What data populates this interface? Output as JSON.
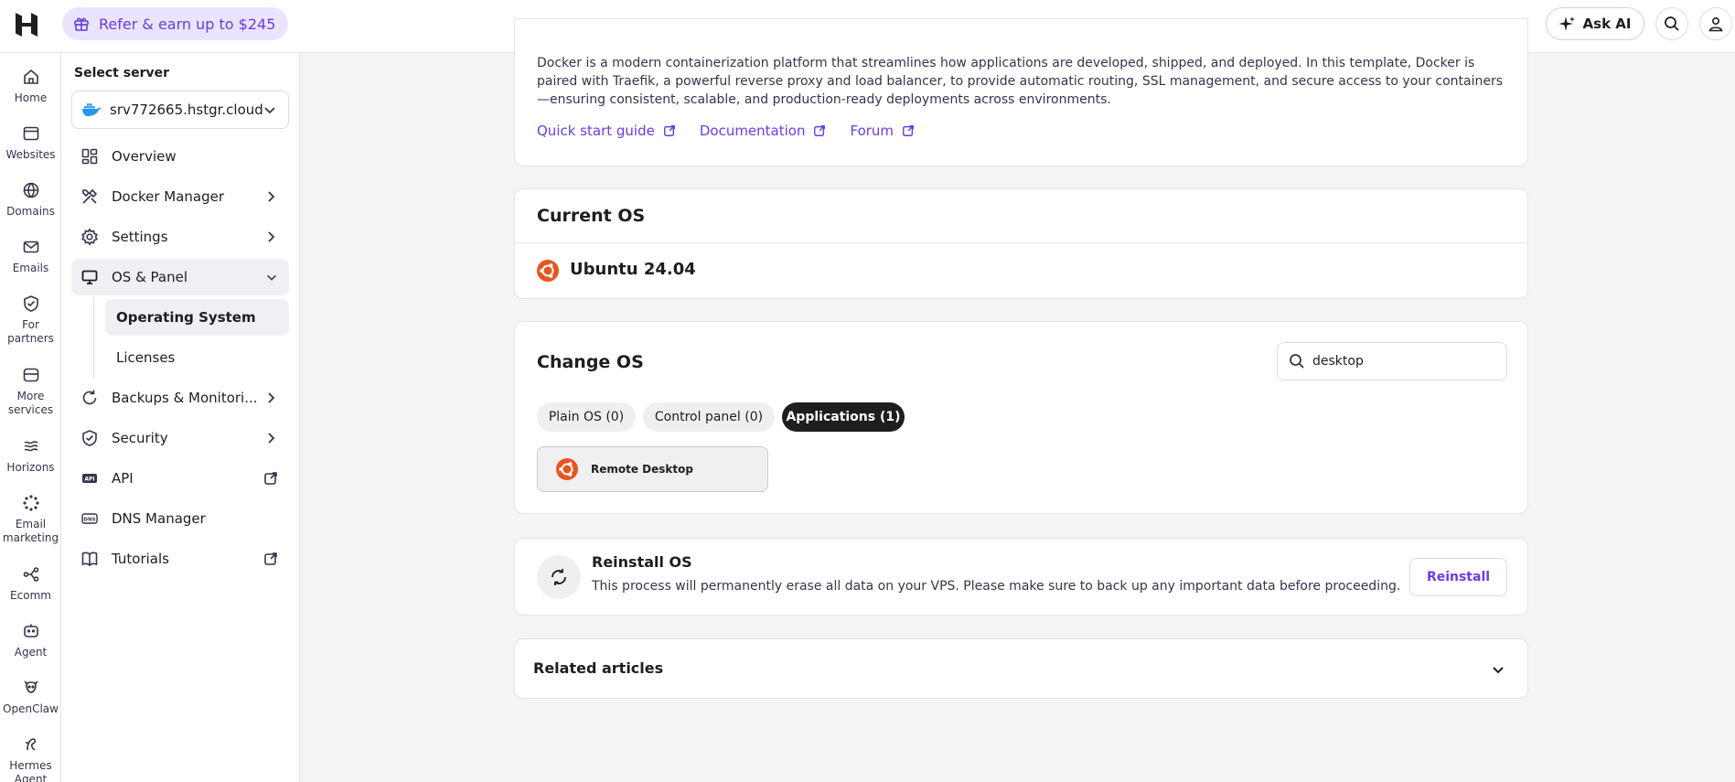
{
  "topbar": {
    "refer_label": "Refer & earn up to $245",
    "ask_ai_label": "Ask AI",
    "accent_color": "#673de6"
  },
  "rail": {
    "items": [
      {
        "label": "Home",
        "icon": "home-icon"
      },
      {
        "label": "Websites",
        "icon": "browser-icon"
      },
      {
        "label": "Domains",
        "icon": "globe-icon"
      },
      {
        "label": "Emails",
        "icon": "mail-icon"
      },
      {
        "label": "For partners",
        "icon": "partner-shield-icon"
      },
      {
        "label": "More services",
        "icon": "store-icon"
      },
      {
        "label": "Horizons",
        "icon": "horizons-icon"
      },
      {
        "label": "Email marketing",
        "icon": "email-marketing-icon"
      },
      {
        "label": "Ecomm",
        "icon": "ecomm-icon"
      },
      {
        "label": "Agent",
        "icon": "agent-icon"
      },
      {
        "label": "OpenClaw",
        "icon": "openclaw-icon"
      },
      {
        "label": "Hermes Agent",
        "icon": "hermes-icon"
      }
    ]
  },
  "sidebar": {
    "select_server_label": "Select server",
    "server_name": "srv772665.hstgr.cloud",
    "items": [
      {
        "label": "Overview"
      },
      {
        "label": "Docker Manager"
      },
      {
        "label": "Settings"
      },
      {
        "label": "OS & Panel"
      },
      {
        "label": "Backups & Monitori..."
      },
      {
        "label": "Security"
      },
      {
        "label": "API"
      },
      {
        "label": "DNS Manager"
      },
      {
        "label": "Tutorials"
      }
    ],
    "sub_items": [
      {
        "label": "Operating System"
      },
      {
        "label": "Licenses"
      }
    ]
  },
  "template_card": {
    "description": "Docker is a modern containerization platform that streamlines how applications are developed, shipped, and deployed. In this template, Docker is paired with Traefik, a powerful reverse proxy and load balancer, to provide automatic routing, SSL management, and secure access to your containers—ensuring consistent, scalable, and production-ready deployments across environments.",
    "links": [
      "Quick start guide",
      "Documentation",
      "Forum"
    ]
  },
  "current_os": {
    "title": "Current OS",
    "os_name": "Ubuntu 24.04",
    "os_color": "#e95420"
  },
  "change_os": {
    "title": "Change OS",
    "search_value": "desktop",
    "tabs": [
      "Plain OS (0)",
      "Control panel (0)",
      "Applications (1)"
    ],
    "active_tab": "Applications (1)",
    "apps": [
      "Remote Desktop"
    ]
  },
  "reinstall": {
    "title": "Reinstall OS",
    "text": "This process will permanently erase all data on your VPS. Please make sure to back up any important data before proceeding.",
    "button_label": "Reinstall"
  },
  "related": {
    "title": "Related articles"
  }
}
